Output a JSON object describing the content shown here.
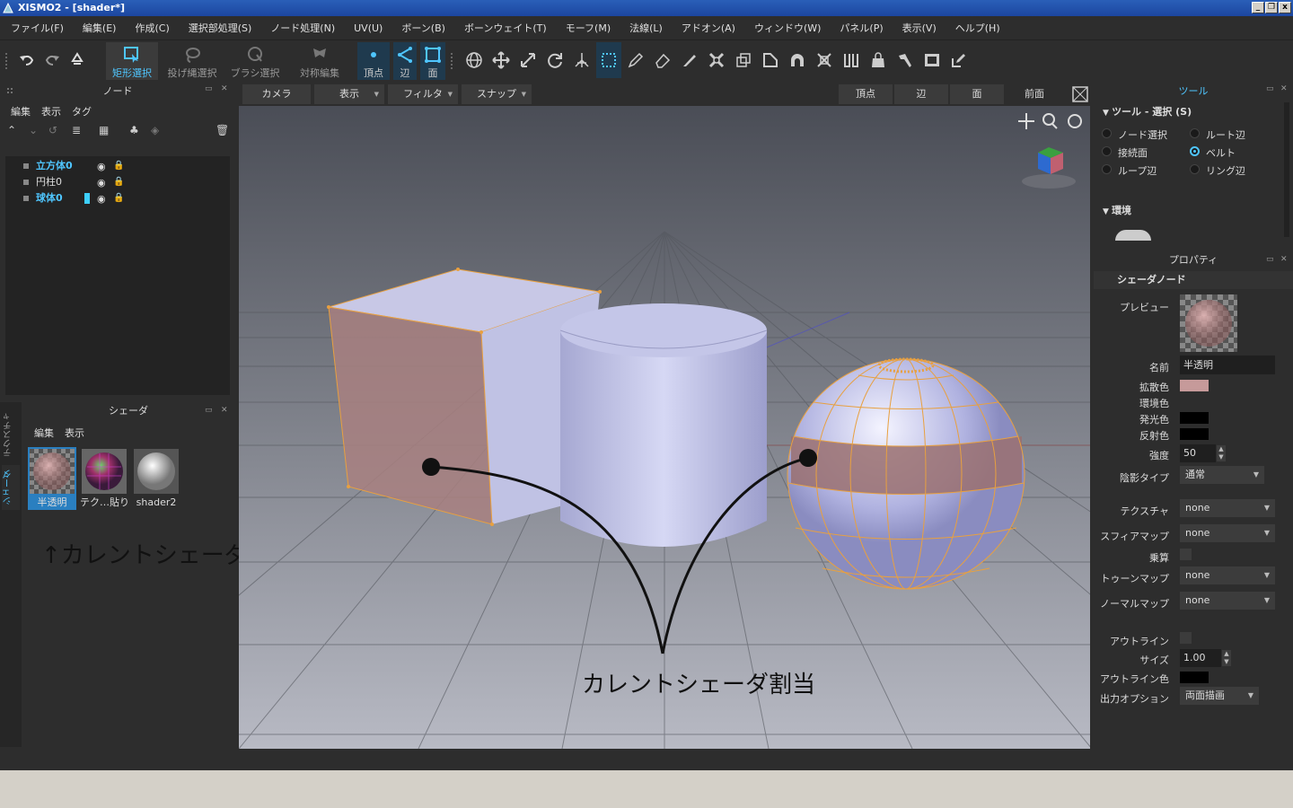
{
  "window": {
    "title": "XISMO2 - [shader*]",
    "minimize": "_",
    "restore": "❐",
    "close": "x"
  },
  "menu": [
    "ファイル(F)",
    "編集(E)",
    "作成(C)",
    "選択部処理(S)",
    "ノード処理(N)",
    "UV(U)",
    "ボーン(B)",
    "ボーンウェイト(T)",
    "モーフ(M)",
    "法線(L)",
    "アドオン(A)",
    "ウィンドウ(W)",
    "パネル(P)",
    "表示(V)",
    "ヘルプ(H)"
  ],
  "toolbar": {
    "rect_select": "矩形選択",
    "lasso_select": "投げ縄選択",
    "brush_select": "ブラシ選択",
    "symmetric_edit": "対称編集",
    "vertex": "頂点",
    "edge": "辺",
    "face": "面"
  },
  "node_panel": {
    "title": "ノード",
    "menu": [
      "編集",
      "表示",
      "タグ"
    ],
    "items": [
      {
        "label": "立方体0",
        "selected": true
      },
      {
        "label": "円柱0",
        "selected": false
      },
      {
        "label": "球体0",
        "selected": true
      }
    ]
  },
  "shader_panel": {
    "title": "シェーダ",
    "menu": [
      "編集",
      "表示"
    ],
    "side_tabs": [
      "テクスチャ",
      "シェーダ"
    ],
    "thumbnails": [
      {
        "label": "半透明",
        "active": true
      },
      {
        "label": "テク…貼り",
        "active": false
      },
      {
        "label": "shader2",
        "active": false
      }
    ]
  },
  "viewport": {
    "buttons": [
      "カメラ",
      "表示",
      "フィルタ",
      "スナップ"
    ],
    "mode_buttons": [
      "頂点",
      "辺",
      "面"
    ],
    "view_name": "前面"
  },
  "annotations": {
    "current_shader": "↑カレントシェーダ",
    "assign": "カレントシェーダ割当"
  },
  "tool_panel": {
    "title": "ツール",
    "section": "ツール - 選択 (S)",
    "radios": [
      {
        "label": "ノード選択",
        "on": false
      },
      {
        "label": "ルート辺",
        "on": false
      },
      {
        "label": "接続面",
        "on": false
      },
      {
        "label": "ベルト",
        "on": true
      },
      {
        "label": "ループ辺",
        "on": false
      },
      {
        "label": "リング辺",
        "on": false
      }
    ],
    "env_section": "環境"
  },
  "property_panel": {
    "title": "プロパティ",
    "section": "シェーダノード",
    "preview_label": "プレビュー",
    "name_label": "名前",
    "name_value": "半透明",
    "diffuse_label": "拡散色",
    "ambient_label": "環境色",
    "emissive_label": "発光色",
    "specular_label": "反射色",
    "intensity_label": "強度",
    "intensity_value": "50",
    "shade_type_label": "陰影タイプ",
    "shade_type_value": "通常",
    "texture_label": "テクスチャ",
    "texture_value": "none",
    "spheremap_label": "スフィアマップ",
    "spheremap_value": "none",
    "multiply_label": "乗算",
    "toonmap_label": "トゥーンマップ",
    "toonmap_value": "none",
    "normalmap_label": "ノーマルマップ",
    "normalmap_value": "none",
    "outline_label": "アウトライン",
    "size_label": "サイズ",
    "size_value": "1.00",
    "outline_color_label": "アウトライン色",
    "output_label": "出力オプション",
    "output_value": "両面描画"
  },
  "colors": {
    "accent": "#4fc6ff",
    "bg": "#2d2d2d",
    "diffuse": "#c69a9a",
    "emissive": "#000000",
    "specular": "#000000"
  }
}
